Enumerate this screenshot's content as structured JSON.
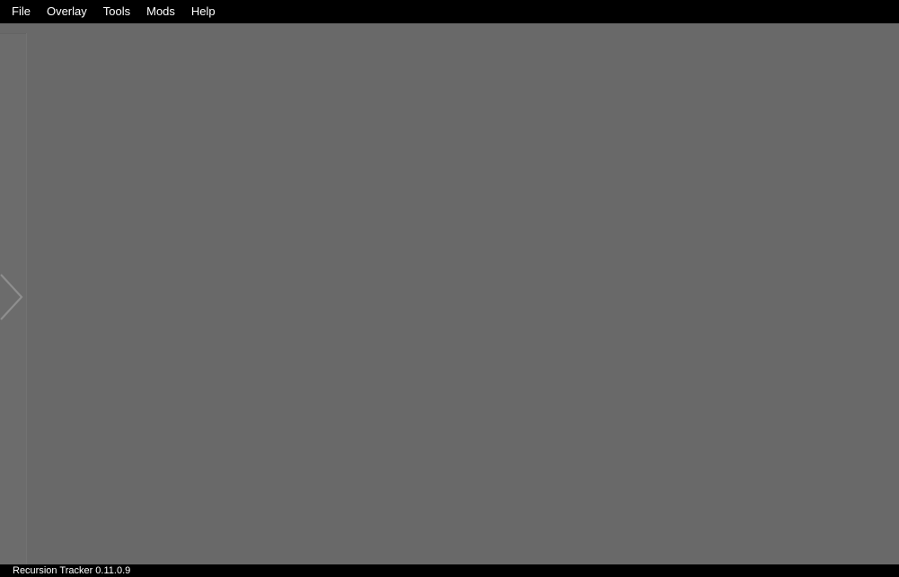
{
  "menubar": {
    "items": [
      {
        "label": "File"
      },
      {
        "label": "Overlay"
      },
      {
        "label": "Tools"
      },
      {
        "label": "Mods"
      },
      {
        "label": "Help"
      }
    ]
  },
  "side_panel": {
    "toggle_icon": "chevron-right-icon"
  },
  "statusbar": {
    "text": "Recursion Tracker 0.11.0.9"
  },
  "colors": {
    "background": "#696969",
    "menubar": "#000000",
    "text": "#ffffff"
  }
}
